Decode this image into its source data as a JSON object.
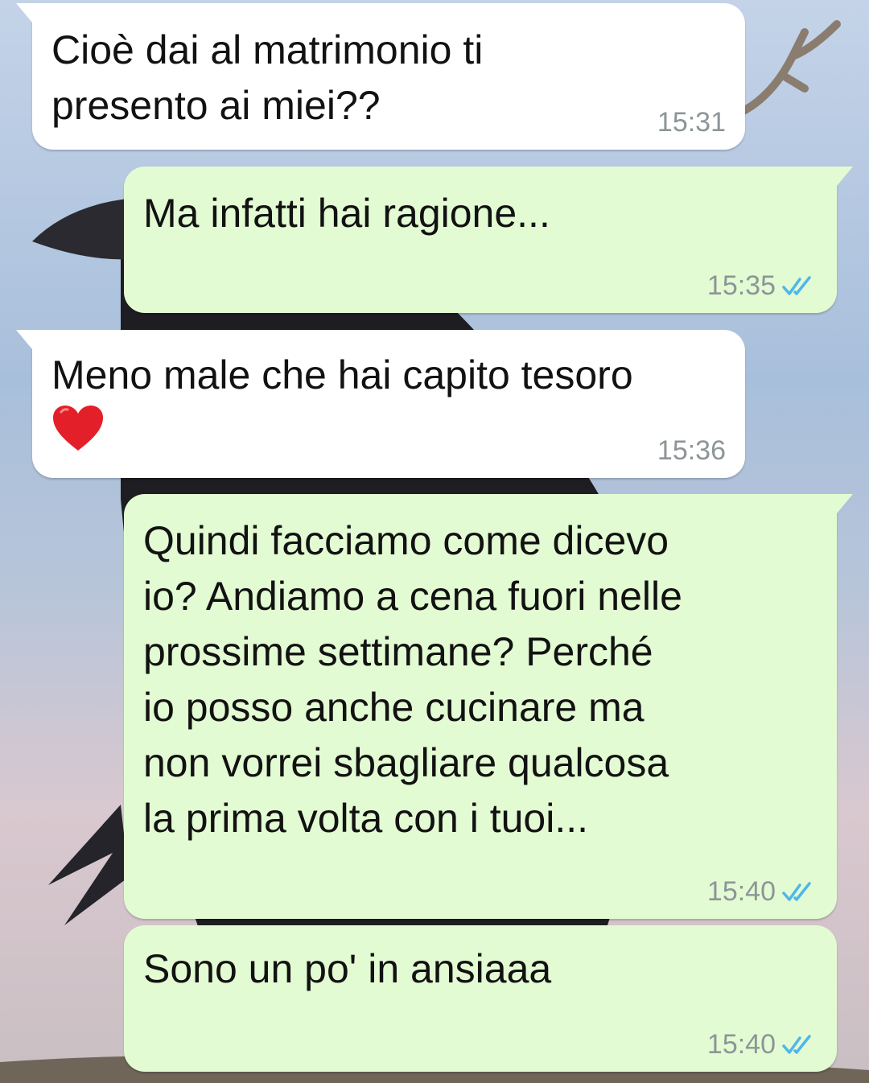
{
  "conversation": {
    "messages": [
      {
        "direction": "incoming",
        "text": "Cioè dai al matrimonio ti\npresento ai miei??",
        "time": "15:31"
      },
      {
        "direction": "outgoing",
        "text": "Ma infatti hai ragione...",
        "time": "15:35",
        "status_icon": "double-check-read-icon"
      },
      {
        "direction": "incoming",
        "text": "Meno male che hai capito tesoro",
        "emoji": "red-heart-icon",
        "time": "15:36"
      },
      {
        "direction": "outgoing",
        "text": "Quindi facciamo come dicevo\nio? Andiamo a cena fuori nelle\nprossime settimane? Perché\nio posso anche cucinare ma\nnon vorrei sbagliare qualcosa\nla prima volta con i tuoi...",
        "time": "15:40",
        "status_icon": "double-check-read-icon"
      },
      {
        "direction": "outgoing",
        "text": "Sono un po' in ansiaaa",
        "time": "15:40",
        "status_icon": "double-check-read-icon"
      }
    ]
  },
  "colors": {
    "incoming_bubble": "#ffffff",
    "outgoing_bubble": "#e3fbd3",
    "read_ticks": "#4fb6ec",
    "timestamp": "#8d9598"
  }
}
